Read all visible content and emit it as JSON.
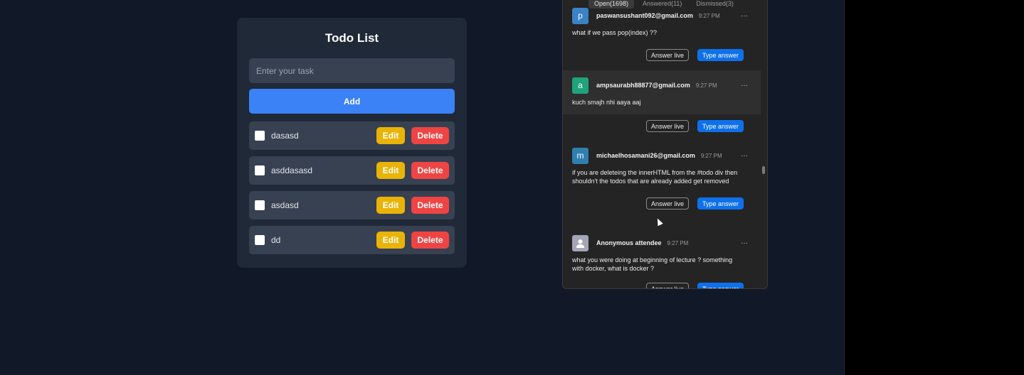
{
  "todo": {
    "title": "Todo List",
    "input_placeholder": "Enter your task",
    "add_label": "Add",
    "edit_label": "Edit",
    "delete_label": "Delete",
    "items": [
      {
        "text": "dasasd"
      },
      {
        "text": "asddasasd"
      },
      {
        "text": "asdasd"
      },
      {
        "text": "dd"
      }
    ]
  },
  "qa": {
    "tabs": [
      "Open(1698)",
      "Answered(11)",
      "Dismissed(3)"
    ],
    "more_glyph": "···",
    "answer_live_label": "Answer live",
    "type_answer_label": "Type answer",
    "questions": [
      {
        "avatar_letter": "p",
        "avatar_color": "#3b82c4",
        "email": "paswansushant092@gmail.com",
        "time": "9:27 PM",
        "text": "what if we pass pop(index) ??"
      },
      {
        "avatar_letter": "a",
        "avatar_color": "#1fa37a",
        "email": "ampsaurabh88877@gmail.com",
        "time": "9:27 PM",
        "text": "kuch smajh nhi aaya aaj"
      },
      {
        "avatar_letter": "m",
        "avatar_color": "#2f7fb0",
        "email": "michaelhosamani26@gmail.com",
        "time": "9:27 PM",
        "text": "if you are deleteing the innerHTML from the #todo div then shouldn't the todos that are already added get removed"
      },
      {
        "avatar_letter": "",
        "avatar_color": "#a5a5b8",
        "email": "Anonymous attendee",
        "time": "9:27 PM",
        "text": "what you were doing at beginning of lecture ? something with docker, what is docker ?"
      }
    ]
  }
}
